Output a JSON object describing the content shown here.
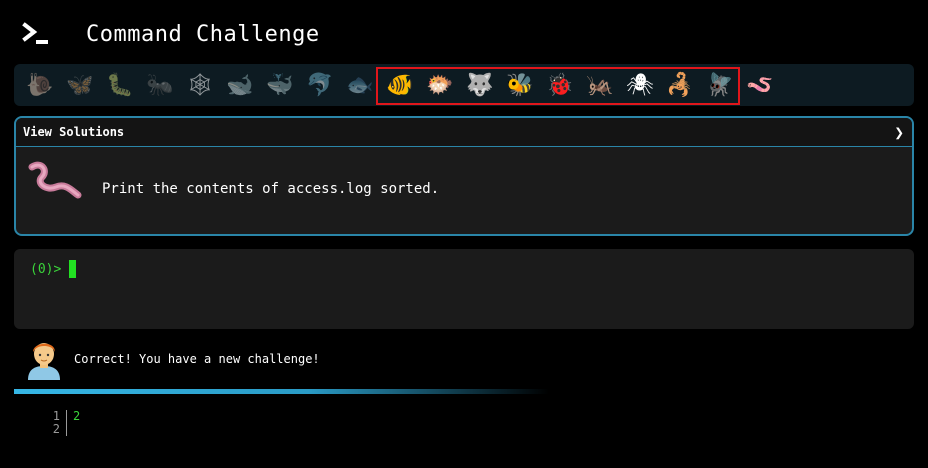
{
  "header": {
    "title": "Command Challenge",
    "icon": "terminal-icon"
  },
  "animals": {
    "items": [
      {
        "name": "snail-icon",
        "glyph": "🐌",
        "dim": true
      },
      {
        "name": "butterfly-icon",
        "glyph": "🦋",
        "dim": true
      },
      {
        "name": "caterpillar-icon",
        "glyph": "🐛",
        "dim": true
      },
      {
        "name": "ant-icon",
        "glyph": "🐜",
        "dim": true
      },
      {
        "name": "spider-web-icon",
        "glyph": "🕸",
        "dim": true
      },
      {
        "name": "whale-icon",
        "glyph": "🐋",
        "dim": true
      },
      {
        "name": "spouting-whale-icon",
        "glyph": "🐳",
        "dim": true
      },
      {
        "name": "dolphin-icon",
        "glyph": "🐬",
        "dim": true
      },
      {
        "name": "fish-icon",
        "glyph": "🐟",
        "dim": true
      },
      {
        "name": "tropical-fish-icon",
        "glyph": "🐠",
        "dim": false
      },
      {
        "name": "blowfish-icon",
        "glyph": "🐡",
        "dim": false
      },
      {
        "name": "wolf-icon",
        "glyph": "🐺",
        "dim": false
      },
      {
        "name": "bee-icon",
        "glyph": "🐝",
        "dim": false
      },
      {
        "name": "ladybug-icon",
        "glyph": "🐞",
        "dim": false
      },
      {
        "name": "cricket-icon",
        "glyph": "🦗",
        "dim": false
      },
      {
        "name": "spider-icon",
        "glyph": "🕷",
        "dim": false
      },
      {
        "name": "scorpion-icon",
        "glyph": "🦂",
        "dim": false
      },
      {
        "name": "fly-icon",
        "glyph": "🪰",
        "dim": false
      },
      {
        "name": "worm-icon",
        "glyph": "🪱",
        "dim": false
      }
    ],
    "highlight_color": "#e0161b"
  },
  "challenge": {
    "header_label": "View Solutions",
    "text": "Print the contents of access.log sorted.",
    "icon": "worm-icon"
  },
  "terminal": {
    "prompt": "(0)>"
  },
  "feedback": {
    "text": "Correct! You have a new challenge!",
    "avatar": "person-avatar"
  },
  "output": {
    "lines": [
      {
        "number": "1",
        "value": "2"
      },
      {
        "number": "2",
        "value": ""
      }
    ]
  },
  "colors": {
    "accent": "#2a85a8",
    "prompt_green": "#3ad43a",
    "cursor_green": "#22e022"
  }
}
